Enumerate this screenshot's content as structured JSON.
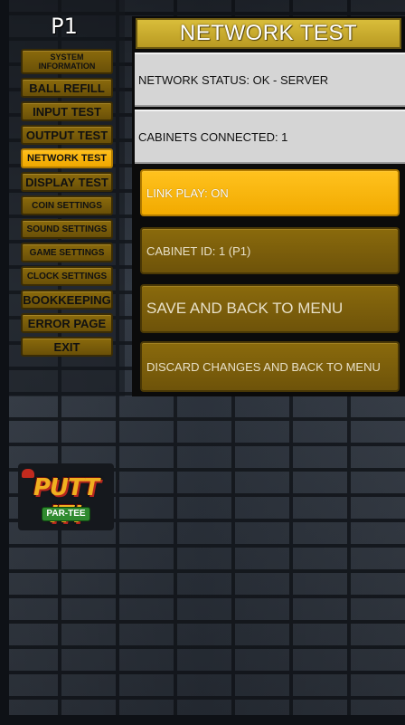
{
  "player_label": "P1",
  "menu": {
    "items": [
      {
        "line1": "SYSTEM",
        "line2": "INFORMATION"
      },
      {
        "label": "BALL REFILL"
      },
      {
        "label": "INPUT TEST"
      },
      {
        "label": "OUTPUT TEST"
      },
      {
        "label": "NETWORK TEST"
      },
      {
        "label": "DISPLAY TEST"
      },
      {
        "label": "COIN SETTINGS"
      },
      {
        "label": "SOUND SETTINGS"
      },
      {
        "label": "GAME SETTINGS"
      },
      {
        "label": "CLOCK SETTINGS"
      },
      {
        "label": "BOOKKEEPING"
      },
      {
        "label": "ERROR PAGE"
      },
      {
        "label": "EXIT"
      }
    ],
    "active": "NETWORK TEST"
  },
  "panel": {
    "title": "NETWORK TEST",
    "network_status": "NETWORK STATUS: OK - SERVER",
    "cabinets_connected": "CABINETS CONNECTED: 1",
    "link_play": "LINK PLAY:   ON",
    "cabinet_id": "CABINET ID:   1 (P1)",
    "save": "SAVE AND BACK TO MENU",
    "discard": "DISCARD CHANGES AND BACK TO MENU"
  },
  "logo": {
    "main": "PUTT IT!",
    "sub": "PAR-TEE"
  },
  "colors": {
    "menu_button": "#7a5e0a",
    "menu_active": "#ffb80a",
    "title_bar": "#c9ab2c",
    "info_box": "#d5d5d5",
    "wall": "#2f3640"
  }
}
